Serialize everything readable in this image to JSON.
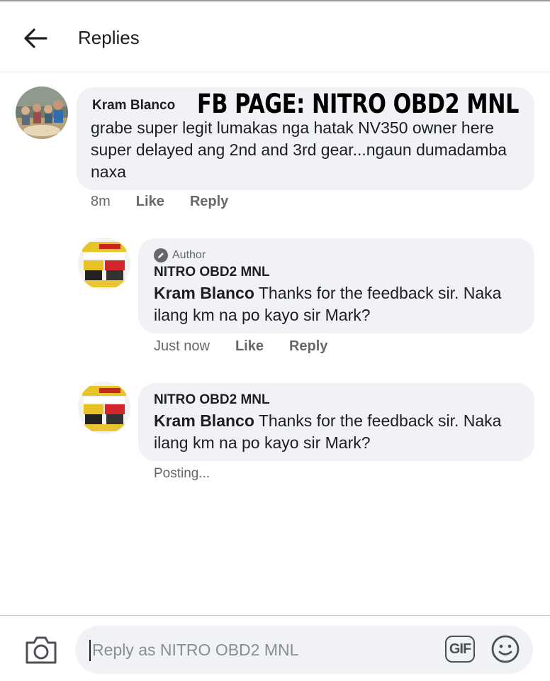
{
  "header": {
    "title": "Replies",
    "back_icon": "arrow-left-icon"
  },
  "overlay": {
    "text": "FB PAGE: NITRO OBD2 MNL"
  },
  "comment": {
    "author": "Kram Blanco",
    "text": "grabe super legit lumakas nga hatak NV350 owner here super delayed ang 2nd and 3rd gear...ngaun dumadamba naxa",
    "time": "8m",
    "like_label": "Like",
    "reply_label": "Reply"
  },
  "replies": [
    {
      "badge": "Author",
      "author": "NITRO OBD2 MNL",
      "mention": "Kram Blanco",
      "text": "Thanks for the feedback sir. Naka ilang km na po kayo sir Mark?",
      "time": "Just now",
      "like_label": "Like",
      "reply_label": "Reply"
    },
    {
      "author": "NITRO OBD2 MNL",
      "mention": "Kram Blanco",
      "text": "Thanks for the feedback sir. Naka ilang km na po kayo sir Mark?",
      "status": "Posting..."
    }
  ],
  "composer": {
    "placeholder": "Reply as NITRO OBD2 MNL",
    "gif_label": "GIF",
    "camera_icon": "camera-icon",
    "emoji_icon": "smiley-icon"
  },
  "colors": {
    "bubble": "#f0f2f5",
    "meta": "#65676b",
    "text": "#1c1e21"
  }
}
